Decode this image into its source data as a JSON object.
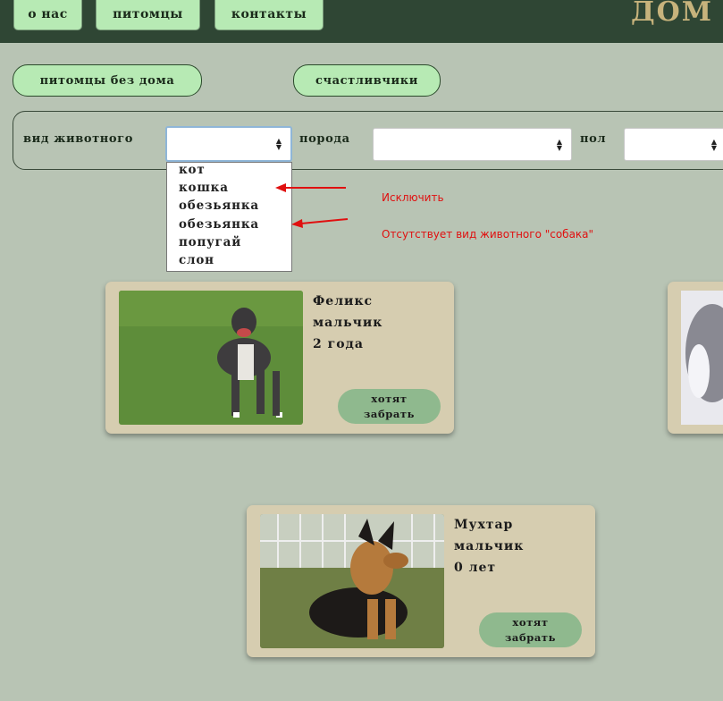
{
  "nav": {
    "items": [
      "о нас",
      "питомцы",
      "контакты"
    ],
    "site_title": "ДОМ П"
  },
  "sections": {
    "homeless_label": "питомцы без дома",
    "happy_label": "счастливчики"
  },
  "filters": {
    "animal_type_label": "вид животного",
    "breed_label": "порода",
    "sex_label": "пол",
    "animal_type_options": [
      "кот",
      "кошка",
      "обезьянка",
      "обезьянка",
      "попугай",
      "слон"
    ]
  },
  "annotations": {
    "exclude": "Исключить",
    "missing": "Отсутствует вид животного \"собака\"",
    "arrow_color": "#e01010"
  },
  "pets": [
    {
      "name": "Феликс",
      "sex": "мальчик",
      "age": "2 года",
      "button": "хотят забрать",
      "photo_icon": "dog-photo"
    },
    {
      "name": "Мухтар",
      "sex": "мальчик",
      "age": "0 лет",
      "button": "хотят забрать",
      "photo_icon": "puppy-photo"
    }
  ],
  "colors": {
    "header": "#2f4634",
    "background": "#b8c4b4",
    "button_green": "#b7eab4",
    "card": "#d6cdb0",
    "adopt_button": "#8fb98e"
  }
}
